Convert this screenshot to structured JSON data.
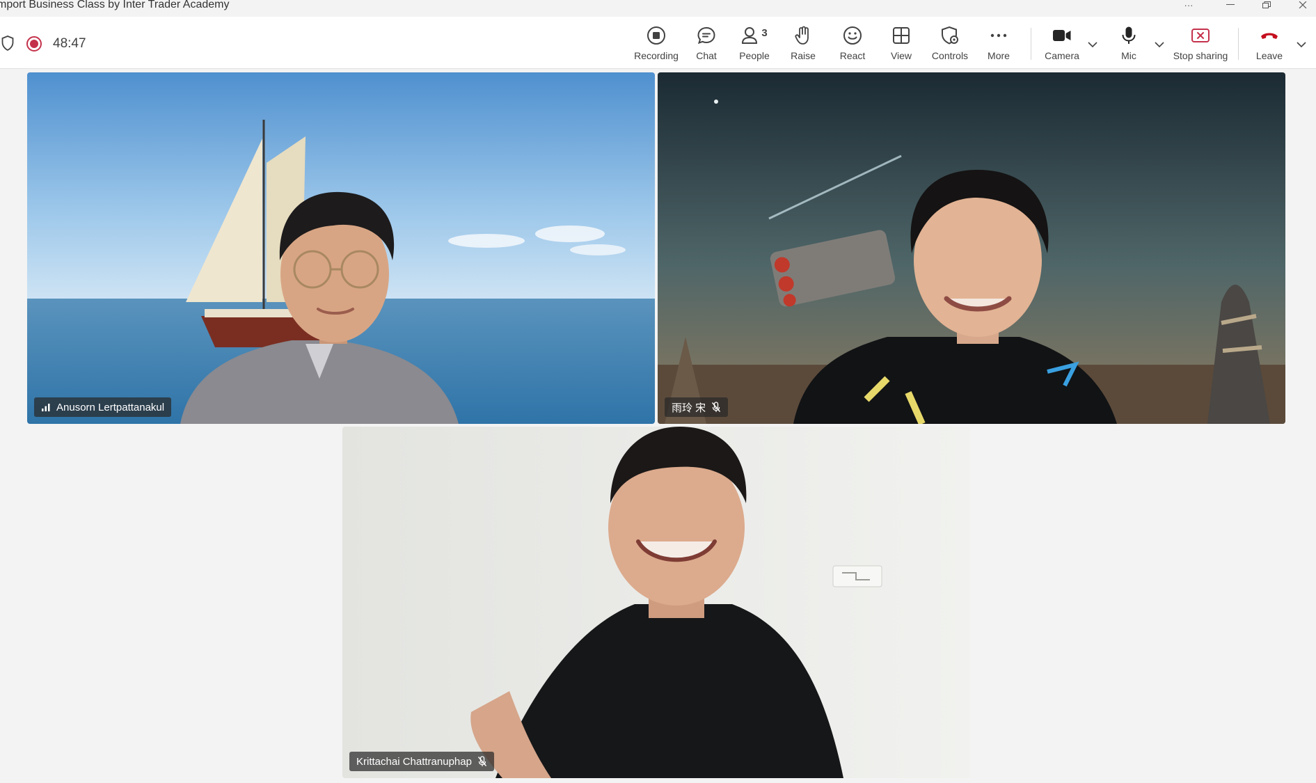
{
  "window": {
    "title": "mport Business Class by Inter Trader Academy"
  },
  "meeting": {
    "timer": "48:47"
  },
  "toolbar": {
    "recording_label": "Recording",
    "chat_label": "Chat",
    "people_label": "People",
    "people_count": "3",
    "raise_label": "Raise",
    "react_label": "React",
    "view_label": "View",
    "controls_label": "Controls",
    "more_label": "More",
    "camera_label": "Camera",
    "mic_label": "Mic",
    "stop_sharing_label": "Stop sharing",
    "leave_label": "Leave"
  },
  "participants": [
    {
      "name": "Anusorn Lertpattanakul",
      "muted": false,
      "background": "sailboat-sea"
    },
    {
      "name": "雨玲 宋",
      "muted": true,
      "background": "space-fantasy"
    },
    {
      "name": "Krittachai Chattranuphap",
      "muted": true,
      "background": "plain-room"
    }
  ],
  "colors": {
    "record_red": "#c4314b",
    "stop_sharing_red": "#c4314b",
    "leave_red": "#c50f1f",
    "toolbar_bg": "#ffffff",
    "stage_bg": "#f3f3f3"
  },
  "icons": {
    "shield": "shield-icon",
    "record": "record-indicator-icon",
    "signal": "signal-bars-icon",
    "mic_off": "mic-off-icon"
  }
}
